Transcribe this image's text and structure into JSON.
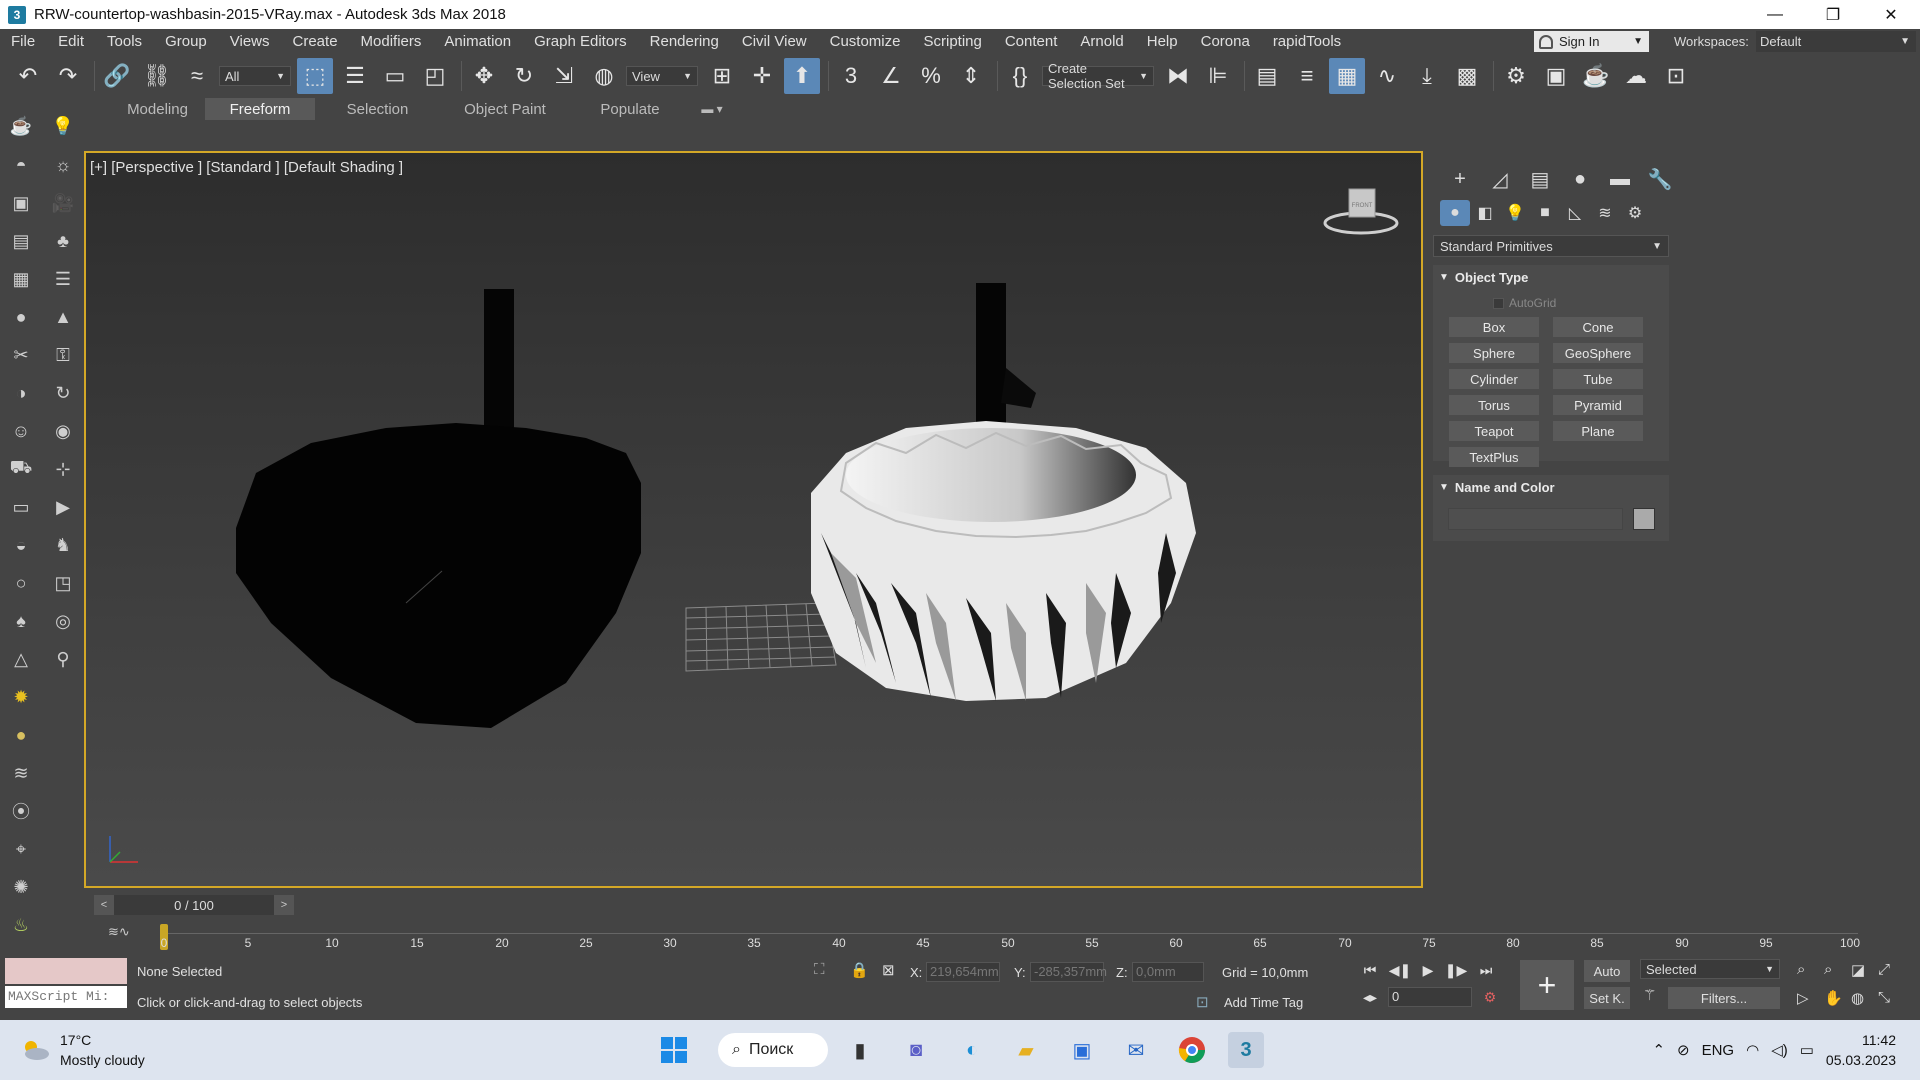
{
  "window": {
    "title": "RRW-countertop-washbasin-2015-VRay.max - Autodesk 3ds Max 2018",
    "app_icon": "3",
    "minimize": "—",
    "restore": "❐",
    "close": "✕"
  },
  "menu": {
    "items": [
      "File",
      "Edit",
      "Tools",
      "Group",
      "Views",
      "Create",
      "Modifiers",
      "Animation",
      "Graph Editors",
      "Rendering",
      "Civil View",
      "Customize",
      "Scripting",
      "Content",
      "Arnold",
      "Help",
      "Corona",
      "rapidTools"
    ],
    "sign_in": "Sign In",
    "workspaces_label": "Workspaces:",
    "workspace_value": "Default"
  },
  "toolbar": {
    "filter_value": "All",
    "view_value": "View",
    "selection_set": "Create Selection Set"
  },
  "ribbon": {
    "tabs": [
      "Modeling",
      "Freeform",
      "Selection",
      "Object Paint",
      "Populate"
    ],
    "active_tab": "Freeform"
  },
  "viewport": {
    "label": "[+] [Perspective ] [Standard ] [Default Shading ]",
    "viewcube_face": "FRONT"
  },
  "timeline": {
    "slider_value": "0 / 100",
    "prev": "<",
    "next": ">",
    "ticks": [
      "0",
      "5",
      "10",
      "15",
      "20",
      "25",
      "30",
      "35",
      "40",
      "45",
      "50",
      "55",
      "60",
      "65",
      "70",
      "75",
      "80",
      "85",
      "90",
      "95",
      "100"
    ]
  },
  "status": {
    "maxscript_placeholder": "MAXScript Mi:",
    "selection_status": "None Selected",
    "prompt": "Click or click-and-drag to select objects",
    "x_label": "X:",
    "x_value": "219,654mm",
    "y_label": "Y:",
    "y_value": "-285,357mm",
    "z_label": "Z:",
    "z_value": "0,0mm",
    "grid": "Grid = 10,0mm",
    "add_time_tag": "Add Time Tag",
    "auto_key": "Auto",
    "set_key": "Set K.",
    "key_mode": "Selected",
    "filters": "Filters...",
    "frame_value": "0"
  },
  "command_panel": {
    "primitive_type": "Standard Primitives",
    "object_type_title": "Object Type",
    "autogrid": "AutoGrid",
    "buttons": [
      "Box",
      "Cone",
      "Sphere",
      "GeoSphere",
      "Cylinder",
      "Tube",
      "Torus",
      "Pyramid",
      "Teapot",
      "Plane",
      "TextPlus"
    ],
    "name_color_title": "Name and Color",
    "swatch_color": "#aaaaaa"
  },
  "taskbar": {
    "temperature": "17°C",
    "weather": "Mostly cloudy",
    "search": "Поиск",
    "language": "ENG",
    "time": "11:42",
    "date": "05.03.2023"
  },
  "colors": {
    "accent": "#5b88b7",
    "viewport_border": "#d4a827"
  }
}
